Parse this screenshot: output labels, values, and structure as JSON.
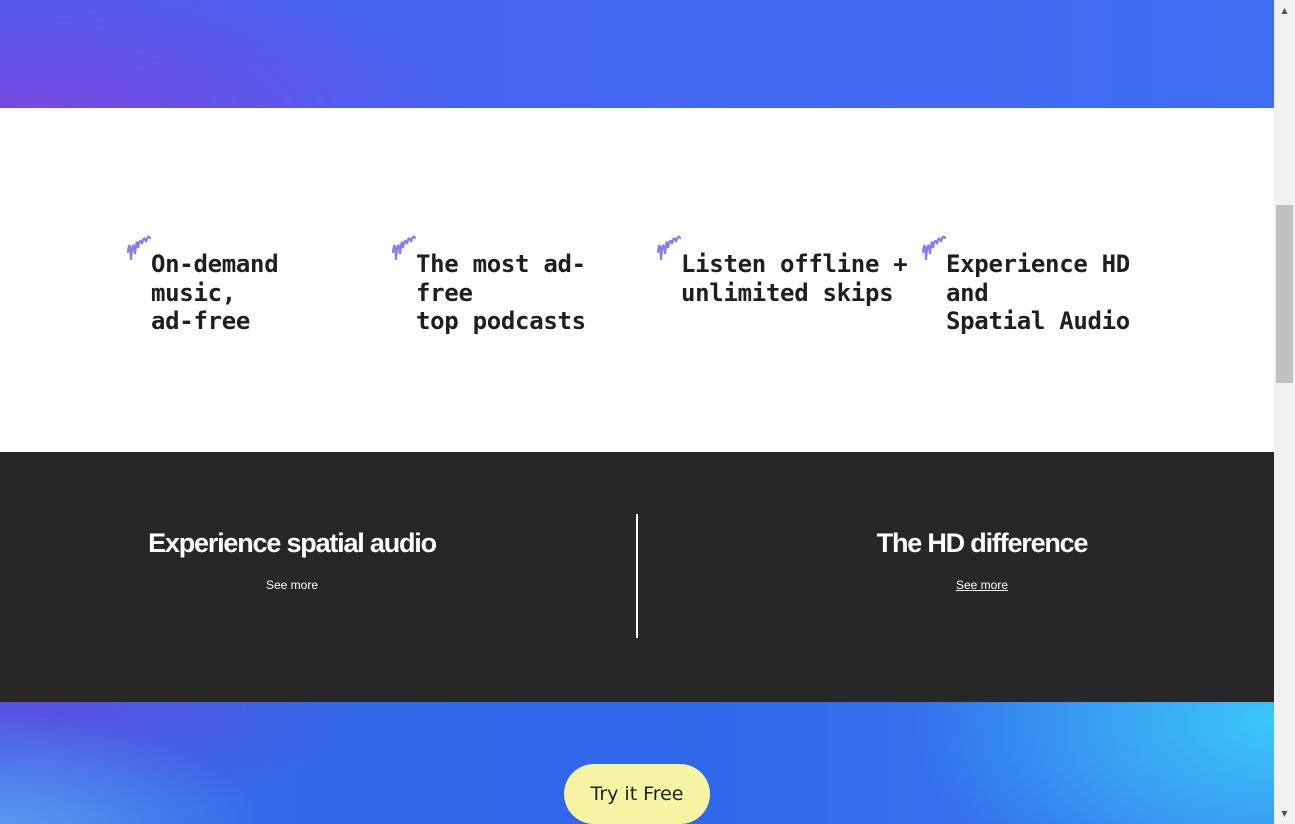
{
  "features": [
    {
      "title": "On-demand\nmusic,\nad-free"
    },
    {
      "title": "The most ad-\nfree\ntop podcasts"
    },
    {
      "title": "Listen offline +\nunlimited skips"
    },
    {
      "title": "Experience HD\nand\nSpatial Audio"
    }
  ],
  "features_icon": "squiggle-icon",
  "info": {
    "left": {
      "title": "Experience spatial audio",
      "link": "See more"
    },
    "right": {
      "title": "The HD difference",
      "link": "See more"
    }
  },
  "cta": {
    "label": "Try it Free"
  },
  "colors": {
    "accent": "#8a7cf0",
    "dark_band": "#272727",
    "cta_bg": "#f4f4a2"
  }
}
